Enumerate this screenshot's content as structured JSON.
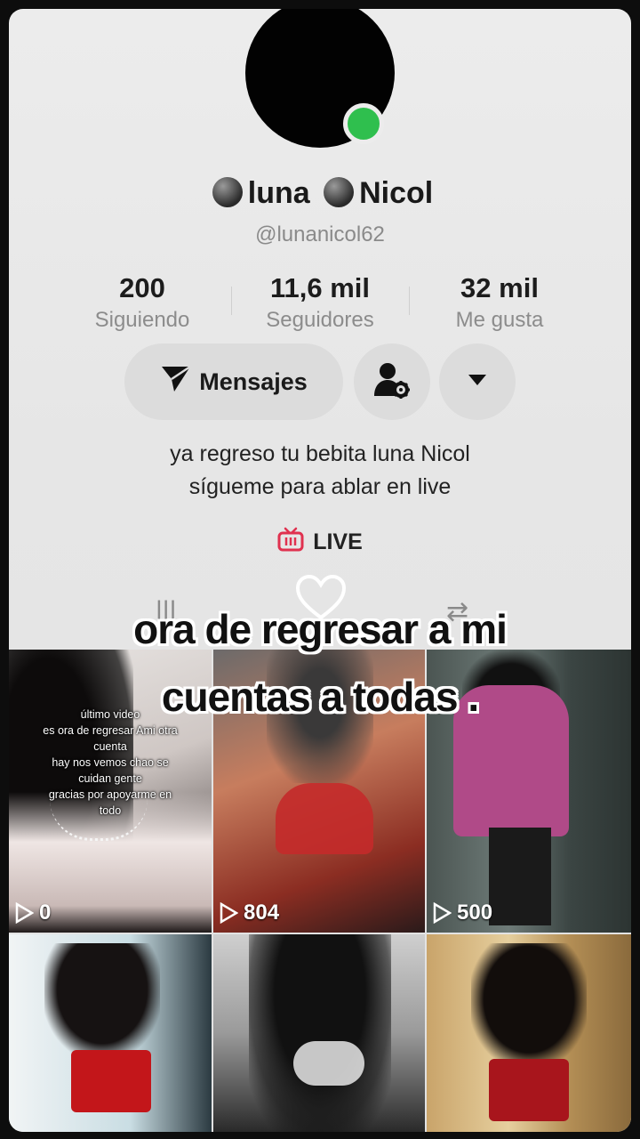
{
  "profile": {
    "display_name": "luna",
    "display_name_2": "Nicol",
    "handle": "@lunanicol62",
    "online_color": "#2fbf4e"
  },
  "stats": [
    {
      "value": "200",
      "label": "Siguiendo"
    },
    {
      "value": "11,6 mil",
      "label": "Seguidores"
    },
    {
      "value": "32 mil",
      "label": "Me gusta"
    }
  ],
  "actions": {
    "message_label": "Mensajes",
    "message_icon": "send-icon",
    "add_friend_icon": "add-user-settings-icon",
    "more_icon": "chevron-down-icon"
  },
  "bio": {
    "line1": "ya regreso tu bebita  luna Nicol",
    "line2": "sígueme para ablar en live"
  },
  "live": {
    "label": "LIVE",
    "icon": "tv-live-icon",
    "color": "#e0314f"
  },
  "caption": {
    "line1": "ora de regresar a mi",
    "line2": "cuentas a todas ."
  },
  "videos": [
    {
      "views": "0",
      "overlay": [
        "último video",
        "es ora de regresar Ami otra",
        "cuenta",
        "hay nos vemos chao se",
        "cuidan gente",
        "gracias por apoyarme en",
        "todo"
      ]
    },
    {
      "views": "804"
    },
    {
      "views": "500"
    },
    {
      "views": ""
    },
    {
      "views": ""
    },
    {
      "views": ""
    }
  ]
}
